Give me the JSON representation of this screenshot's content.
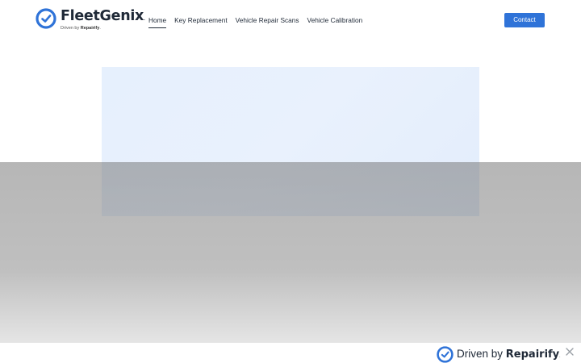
{
  "brand": {
    "name": "FleetGenix",
    "trademark": ".",
    "tagline_prefix": "Driven by",
    "tagline_brand": "Repairify",
    "tagline_suffix": ".",
    "color": "#2f73d8"
  },
  "nav": {
    "items": [
      {
        "label": "Home",
        "active": true
      },
      {
        "label": "Key Replacement",
        "active": false
      },
      {
        "label": "Vehicle Repair Scans",
        "active": false
      },
      {
        "label": "Vehicle Calibration",
        "active": false
      }
    ]
  },
  "header": {
    "contact_label": "Contact"
  },
  "banner": {
    "prefix": "Driven by",
    "brand": "Repairify",
    "suffix": ".",
    "close_icon": "close-icon"
  },
  "colors": {
    "accent": "#2f73d8",
    "hero_bg": "#e6f0fd"
  }
}
